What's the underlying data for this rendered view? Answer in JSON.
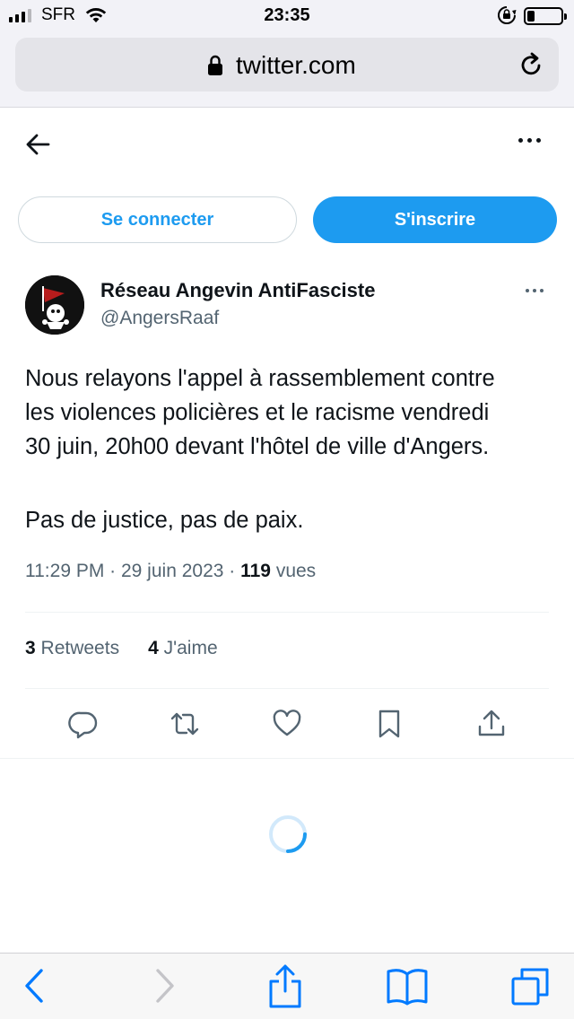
{
  "status_bar": {
    "carrier": "SFR",
    "time": "23:35",
    "battery_level": 0.15
  },
  "browser": {
    "url": "twitter.com"
  },
  "auth": {
    "login_label": "Se connecter",
    "signup_label": "S'inscrire"
  },
  "tweet": {
    "author_name": "Réseau Angevin AntiFasciste",
    "author_handle": "@AngersRaaf",
    "lines": [
      "Nous relayons l'appel à rassemblement contre",
      "les violences policières et le racisme vendredi",
      "30 juin, 20h00 devant l'hôtel de ville d'Angers."
    ],
    "paragraph2": "Pas de justice, pas de paix.",
    "timestamp": "11:29 PM · 29 juin 2023 · ",
    "views_count": "119",
    "views_label": " vues",
    "retweets_count": "3",
    "retweets_label": "Retweets",
    "likes_count": "4",
    "likes_label": "J'aime"
  },
  "colors": {
    "accent": "#1d9bf0",
    "text_primary": "#0f1419",
    "text_secondary": "#536471",
    "ios_tint": "#007aff"
  },
  "icons": {
    "actions": [
      "reply-icon",
      "retweet-icon",
      "like-icon",
      "bookmark-icon",
      "share-icon"
    ],
    "toolbar": [
      "back-icon",
      "forward-icon",
      "share-icon",
      "bookmarks-icon",
      "tabs-icon"
    ]
  }
}
